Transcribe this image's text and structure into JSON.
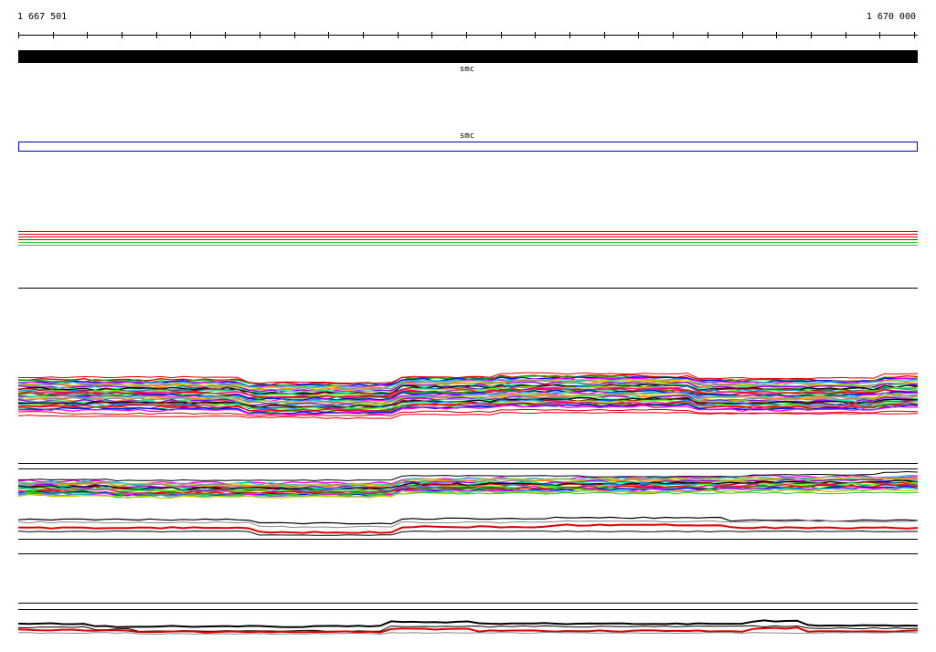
{
  "ruler": {
    "start_label": "1 667 501",
    "end_label": "1 670 000",
    "start": 1667501,
    "end": 1670000,
    "tick_count": 26
  },
  "features": {
    "gene_name_track1": "smc",
    "gene_name_track2": "smc",
    "track1_color": "#000000",
    "track2_color": "#0000aa"
  },
  "palette": {
    "ruler": "#000000",
    "divider": "#000000",
    "red": "#e00000",
    "green": "#22cc22",
    "black": "#000000",
    "multi": [
      "#e00000",
      "#00aa00",
      "#0000ff",
      "#ff00ff",
      "#00cccc",
      "#cccc00",
      "#888888",
      "#ff8800",
      "#8800ff",
      "#00ff88",
      "#000000",
      "#aa0000",
      "#0088ff",
      "#66ff00",
      "#ff0088"
    ]
  }
}
